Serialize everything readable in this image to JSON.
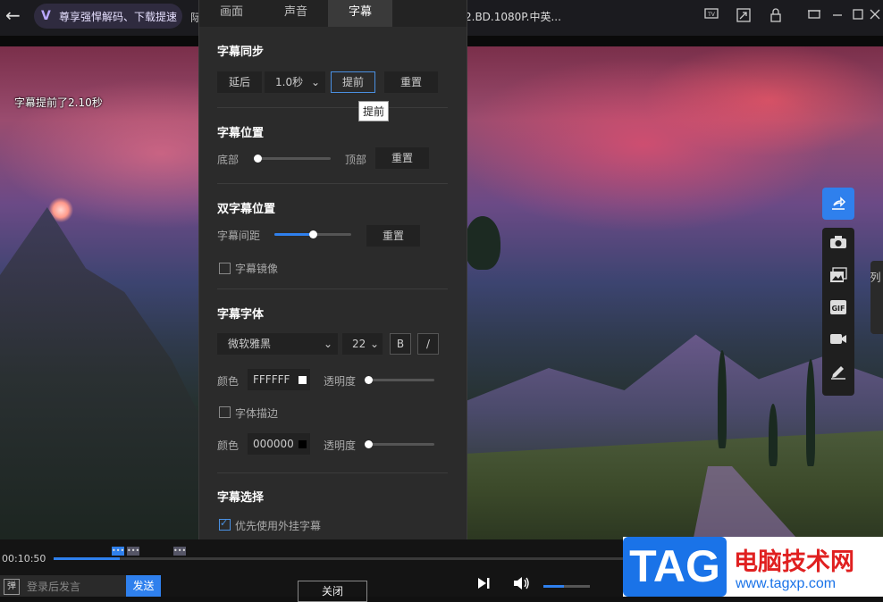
{
  "topbar": {
    "back": "←",
    "vip_label": "尊享强悍解码、下载提速",
    "vip_icon": "V",
    "title_fragment": "际",
    "file_title": "2.BD.1080P.中英...",
    "icons": [
      "tv-icon",
      "pip-icon",
      "lock-icon",
      "mini-mode-icon",
      "minimize-icon",
      "maximize-icon",
      "close-icon"
    ]
  },
  "osd": "字幕提前了2.10秒",
  "panel": {
    "tabs": [
      "画面",
      "声音",
      "字幕"
    ],
    "active_tab": "字幕",
    "sync": {
      "title": "字幕同步",
      "delay": "延后",
      "step": "1.0秒",
      "advance": "提前",
      "reset": "重置",
      "tooltip": "提前"
    },
    "position": {
      "title": "字幕位置",
      "left": "底部",
      "right": "顶部",
      "reset": "重置",
      "level": 0.05
    },
    "dual": {
      "title": "双字幕位置",
      "spacing": "字幕间距",
      "reset": "重置",
      "level": 0.5,
      "mirror": "字幕镜像"
    },
    "font": {
      "title": "字幕字体",
      "family": "微软雅黑",
      "size": "22",
      "bold": "B",
      "italic": "/",
      "color_label": "颜色",
      "color_value": "FFFFFF",
      "opacity_label": "透明度",
      "stroke": "字体描边",
      "stroke_color_label": "颜色",
      "stroke_color_value": "000000",
      "stroke_opacity_label": "透明度"
    },
    "select": {
      "title": "字幕选择",
      "prefer_external": "优先使用外挂字幕"
    },
    "close": "关闭"
  },
  "sidebar": {
    "share": "share-icon",
    "items": [
      "camera-icon",
      "gallery-icon",
      "gif-icon",
      "video-record-icon",
      "pen-icon"
    ],
    "list_tab": "列"
  },
  "bottom": {
    "time": "00:10:50",
    "progress": 0.08,
    "danmu_icon": "弹",
    "danmu_placeholder": "登录后发言",
    "send": "发送",
    "marks": [
      "•••",
      "•••",
      "•••"
    ],
    "volume": 0.45
  },
  "watermark": {
    "tag": "TAG",
    "name": "电脑技术网",
    "url": "www.tagxp.com"
  },
  "colors": {
    "accent": "#2f80ed",
    "panel_bg": "#2b2b2b",
    "watermark_red": "#e02020"
  }
}
